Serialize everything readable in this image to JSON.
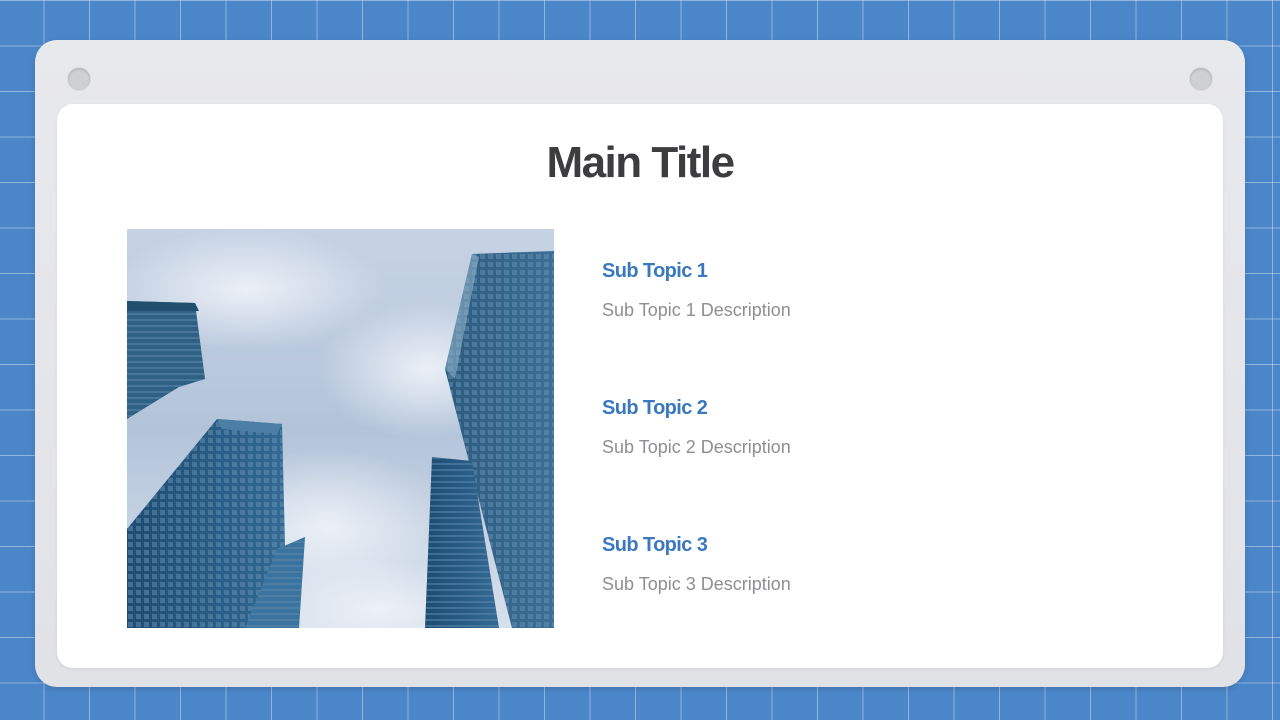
{
  "slide": {
    "title": "Main Title",
    "image_icon": "skyscrapers-photo",
    "topics": [
      {
        "title": "Sub Topic 1",
        "description": "Sub Topic 1 Description"
      },
      {
        "title": "Sub Topic 2",
        "description": "Sub Topic 2 Description"
      },
      {
        "title": "Sub Topic 3",
        "description": "Sub Topic 3 Description"
      }
    ]
  },
  "colors": {
    "background": "#4a86c8",
    "accent": "#3a78c0",
    "title": "#3d3d3f",
    "description": "#8e8e93",
    "frame": "#e5e6e9"
  }
}
